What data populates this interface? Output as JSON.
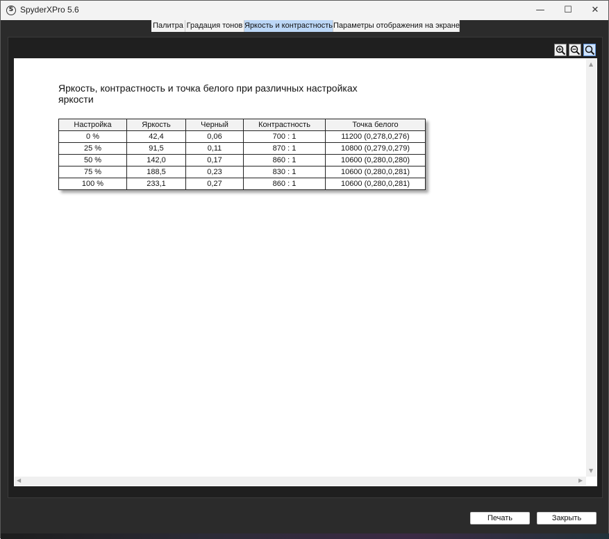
{
  "window": {
    "title": "SpyderXPro 5.6",
    "app_icon_letter": "S"
  },
  "window_controls": {
    "minimize": "—",
    "maximize": "☐",
    "close": "✕"
  },
  "tabs": [
    {
      "label": "Палитра",
      "active": false
    },
    {
      "label": "Градация тонов",
      "active": false
    },
    {
      "label": "Яркость и контрастность",
      "active": true
    },
    {
      "label": "Параметры отображения на экране",
      "active": false
    }
  ],
  "toolbar": {
    "icons": [
      "zoom-in-icon",
      "zoom-out-icon",
      "zoom-fit-icon"
    ],
    "selected": "zoom-fit-icon"
  },
  "report": {
    "title": "Яркость, контрастность и точка белого при различных настройках яркости",
    "columns": [
      "Настройка",
      "Яркость",
      "Черный",
      "Контрастность",
      "Точка белого"
    ],
    "rows": [
      [
        "0 %",
        "42,4",
        "0,06",
        "700 : 1",
        "11200 (0,278,0,276)"
      ],
      [
        "25 %",
        "91,5",
        "0,11",
        "870 : 1",
        "10800 (0,279,0,279)"
      ],
      [
        "50 %",
        "142,0",
        "0,17",
        "860 : 1",
        "10600 (0,280,0,280)"
      ],
      [
        "75 %",
        "188,5",
        "0,23",
        "830 : 1",
        "10600 (0,280,0,281)"
      ],
      [
        "100 %",
        "233,1",
        "0,27",
        "860 : 1",
        "10600 (0,280,0,281)"
      ]
    ]
  },
  "scroll_arrows": {
    "up": "▲",
    "down": "▼",
    "left": "◀",
    "right": "▶"
  },
  "footer": {
    "print_label": "Печать",
    "close_label": "Закрыть"
  },
  "colors": {
    "active_tab": "#bcd7f7",
    "frame": "#2b2b2b",
    "panel": "#1f1f1f"
  }
}
